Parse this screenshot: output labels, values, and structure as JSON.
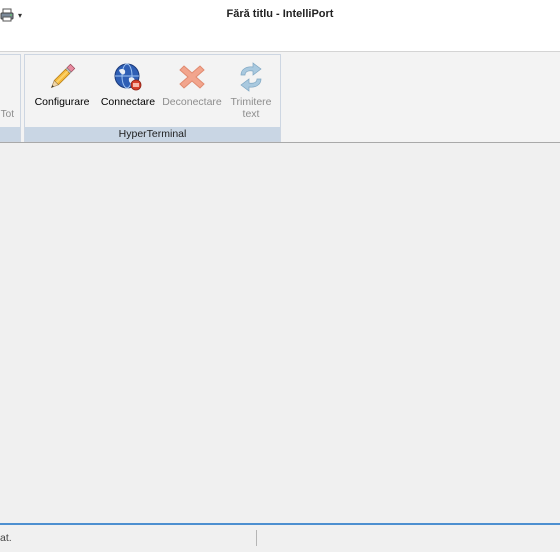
{
  "window": {
    "title": "Fără titlu - IntelliPort",
    "quick_access": [
      "printer-icon",
      "customize-dropdown-icon"
    ]
  },
  "ribbon": {
    "previous_group_partial_label": "Tot",
    "group": {
      "caption": "HyperTerminal",
      "buttons": [
        {
          "label": "Configurare",
          "icon": "pencil-icon",
          "enabled": true
        },
        {
          "label": "Connectare",
          "icon": "globe-connect-icon",
          "enabled": true
        },
        {
          "label": "Deconectare",
          "icon": "disconnect-x-icon",
          "enabled": false
        },
        {
          "label": "Trimitere\ntext",
          "icon": "send-text-arrows-icon",
          "enabled": false
        }
      ]
    }
  },
  "status_bar": {
    "text": "at."
  },
  "colors": {
    "group_caption_bg": "#c9d6e4",
    "status_accent": "#4d8fd0",
    "disabled_text": "#8d8d8d"
  }
}
